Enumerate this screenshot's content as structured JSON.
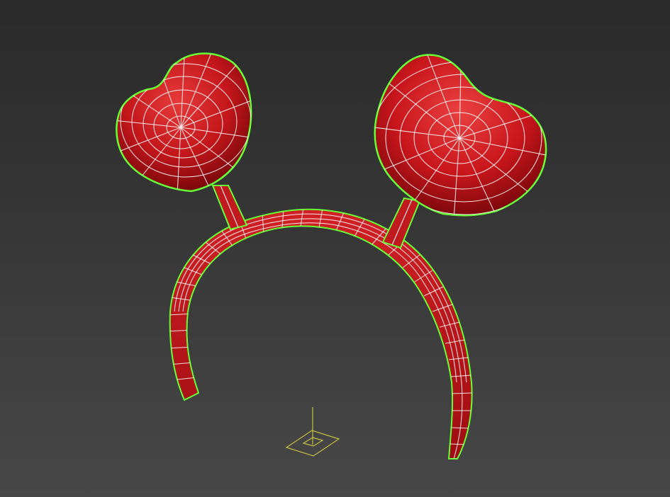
{
  "viewport": {
    "kind": "3d-perspective-viewport",
    "background_top": "#2a2a2a",
    "background_bottom": "#474747"
  },
  "model": {
    "object": "heart-headband",
    "display_mode": "shaded-with-edged-faces",
    "surface_color": "#c4161c",
    "wire_color": "#ffffff",
    "selection_outline_color": "#66ff33"
  },
  "gizmo": {
    "icon": "pivot-gizmo-icon",
    "color": "#c8c040"
  }
}
